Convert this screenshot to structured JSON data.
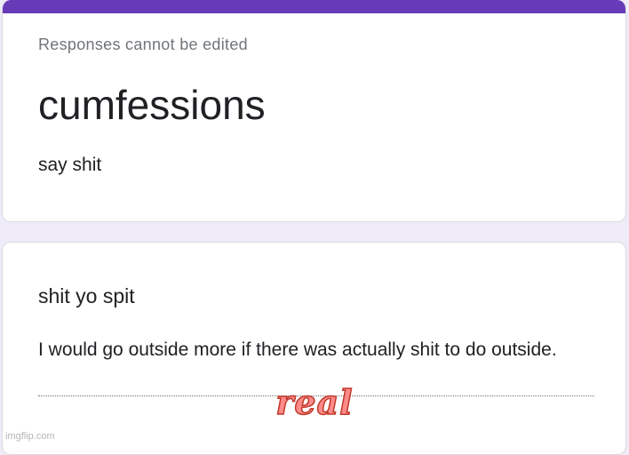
{
  "form": {
    "notice": "Responses cannot be edited",
    "title": "cumfessions",
    "description": "say shit"
  },
  "question": {
    "title": "shit yo spit",
    "answer": "I would go outside more if there was actually shit to do outside."
  },
  "overlay": {
    "caption": "real",
    "watermark": "imgflip.com"
  },
  "colors": {
    "accent": "#673ab7",
    "background": "#f0ebf8",
    "caption_fill": "#ff8a8a",
    "caption_outline": "#c0392b"
  }
}
